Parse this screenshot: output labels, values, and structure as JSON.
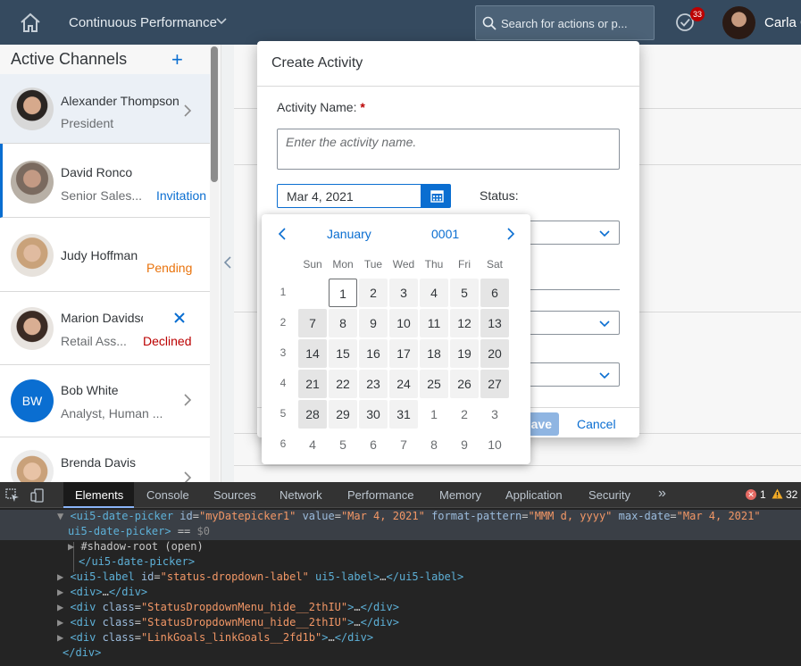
{
  "shell": {
    "app_title": "Continuous Performance",
    "search_placeholder": "Search for actions or p...",
    "notification_count": "33",
    "user_name": "Carla G"
  },
  "channels": {
    "title": "Active Channels",
    "add_label": "+",
    "contacts": [
      {
        "name": "Alexander Thompson",
        "role": "President",
        "status": "",
        "initials": ""
      },
      {
        "name": "David Ronco",
        "role": "Senior Sales...",
        "status": "Invitation",
        "initials": ""
      },
      {
        "name": "Judy Hoffman",
        "role": "",
        "status": "Pending",
        "initials": ""
      },
      {
        "name": "Marion Davidsc",
        "role": "Retail Ass...",
        "status": "Declined",
        "initials": ""
      },
      {
        "name": "Bob White",
        "role": "Analyst, Human ...",
        "status": "",
        "initials": "BW"
      },
      {
        "name": "Brenda Davis",
        "role": "",
        "status": "",
        "initials": ""
      }
    ]
  },
  "dialog": {
    "title": "Create Activity",
    "activity_name_label": "Activity Name:",
    "required_mark": "*",
    "activity_name_placeholder": "Enter the activity name.",
    "date_value": "Mar 4, 2021",
    "status_label": "Status:",
    "save_label": "ave",
    "cancel_label": "Cancel"
  },
  "calendar": {
    "month": "January",
    "year": "0001",
    "weekdays": [
      "Sun",
      "Mon",
      "Tue",
      "Wed",
      "Thu",
      "Fri",
      "Sat"
    ],
    "weeks": [
      {
        "number": "1",
        "days": [
          "",
          "1",
          "2",
          "3",
          "4",
          "5",
          "6"
        ]
      },
      {
        "number": "2",
        "days": [
          "7",
          "8",
          "9",
          "10",
          "11",
          "12",
          "13"
        ]
      },
      {
        "number": "3",
        "days": [
          "14",
          "15",
          "16",
          "17",
          "18",
          "19",
          "20"
        ]
      },
      {
        "number": "4",
        "days": [
          "21",
          "22",
          "23",
          "24",
          "25",
          "26",
          "27"
        ]
      },
      {
        "number": "5",
        "days": [
          "28",
          "29",
          "30",
          "31",
          "1",
          "2",
          "3"
        ]
      },
      {
        "number": "6",
        "days": [
          "4",
          "5",
          "6",
          "7",
          "8",
          "9",
          "10"
        ]
      }
    ]
  },
  "devtools": {
    "tabs": [
      "Elements",
      "Console",
      "Sources",
      "Network",
      "Performance",
      "Memory",
      "Application",
      "Security"
    ],
    "more_label": "»",
    "error_count": "1",
    "warning_count": "32",
    "lines": [
      {
        "indent": "  ▼",
        "parts": [
          [
            "tag",
            "<ui5-date-picker "
          ],
          [
            "attr",
            "id"
          ],
          [
            "txt",
            "="
          ],
          [
            "val",
            "\"myDatepicker1\""
          ],
          [
            "attr",
            " value"
          ],
          [
            "txt",
            "="
          ],
          [
            "val",
            "\"Mar 4, 2021\""
          ],
          [
            "attr",
            " format-pattern"
          ],
          [
            "txt",
            "="
          ],
          [
            "val",
            "\"MMM d, yyyy\""
          ],
          [
            "attr",
            " max-date"
          ],
          [
            "txt",
            "="
          ],
          [
            "val",
            "\"Mar 4, 2021\""
          ]
        ]
      },
      {
        "indent": "  ",
        "parts": [
          [
            "tag",
            "ui5-date-picker>"
          ],
          [
            "txt",
            " == "
          ],
          [
            "dim",
            "$0"
          ]
        ]
      },
      {
        "indent": "     ▶",
        "parts": [
          [
            "txt",
            "#shadow-root (open)"
          ]
        ]
      },
      {
        "indent": "     ",
        "parts": [
          [
            "tag",
            "</ui5-date-picker>"
          ]
        ]
      },
      {
        "indent": "  ▶",
        "parts": [
          [
            "tag",
            "<ui5-label "
          ],
          [
            "attr",
            "id"
          ],
          [
            "txt",
            "="
          ],
          [
            "val",
            "\"status-dropdown-label\""
          ],
          [
            "tag",
            " ui5-label>"
          ],
          [
            "txt",
            "…"
          ],
          [
            "tag",
            "</ui5-label>"
          ]
        ]
      },
      {
        "indent": "  ▶",
        "parts": [
          [
            "tag",
            "<div>"
          ],
          [
            "txt",
            "…"
          ],
          [
            "tag",
            "</div>"
          ]
        ]
      },
      {
        "indent": "  ▶",
        "parts": [
          [
            "tag",
            "<div "
          ],
          [
            "attr",
            "class"
          ],
          [
            "txt",
            "="
          ],
          [
            "val",
            "\"StatusDropdownMenu_hide__2thIU\""
          ],
          [
            "tag",
            ">"
          ],
          [
            "txt",
            "…"
          ],
          [
            "tag",
            "</div>"
          ]
        ]
      },
      {
        "indent": "  ▶",
        "parts": [
          [
            "tag",
            "<div "
          ],
          [
            "attr",
            "class"
          ],
          [
            "txt",
            "="
          ],
          [
            "val",
            "\"StatusDropdownMenu_hide__2thIU\""
          ],
          [
            "tag",
            ">"
          ],
          [
            "txt",
            "…"
          ],
          [
            "tag",
            "</div>"
          ]
        ]
      },
      {
        "indent": "  ▶",
        "parts": [
          [
            "tag",
            "<div "
          ],
          [
            "attr",
            "class"
          ],
          [
            "txt",
            "="
          ],
          [
            "val",
            "\"LinkGoals_linkGoals__2fd1b\""
          ],
          [
            "tag",
            ">"
          ],
          [
            "txt",
            "…"
          ],
          [
            "tag",
            "</div>"
          ]
        ]
      },
      {
        "indent": "  ",
        "parts": [
          [
            "tag",
            "</div>"
          ]
        ]
      }
    ]
  },
  "colors": {
    "shell": "#354a5f",
    "accent": "#0a6ed1",
    "pending": "#e9730c",
    "declined": "#bb0000"
  }
}
